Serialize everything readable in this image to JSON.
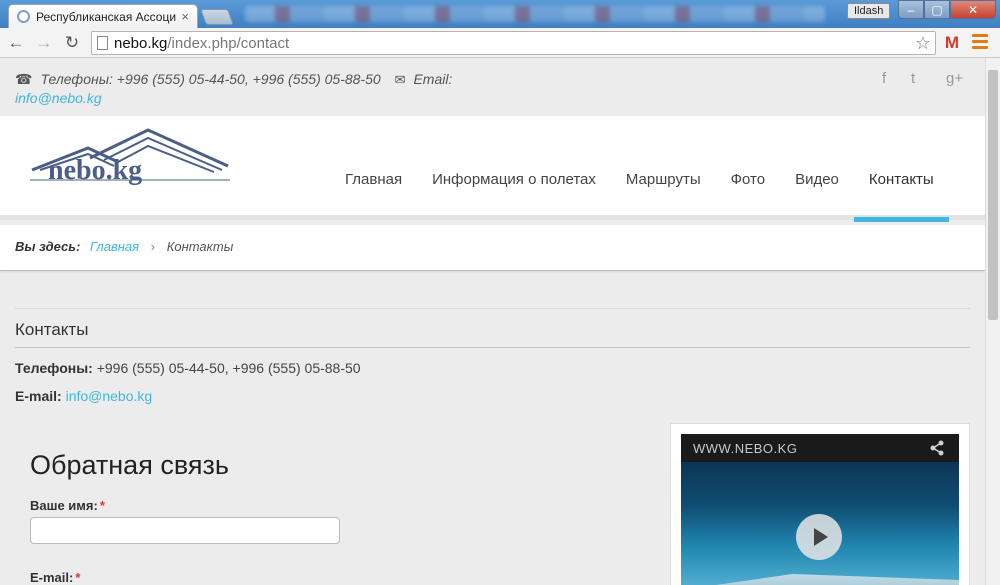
{
  "browser": {
    "tab_title": "Республиканская Ассоци",
    "tab_close": "×",
    "user": "Ildash",
    "url_host": "nebo.kg",
    "url_path": "/index.php/contact",
    "window_min": "–",
    "window_max": "▢",
    "window_close": "✕"
  },
  "topbar": {
    "phones_label": "Телефоны: +996 (555) 05-44-50, +996 (555) 05-88-50",
    "email_label": "Email:",
    "email": "info@nebo.kg",
    "social": [
      "f",
      "t",
      "g+"
    ]
  },
  "logo": {
    "text": "nebo.kg"
  },
  "nav": [
    {
      "label": "Главная"
    },
    {
      "label": "Информация о полетах"
    },
    {
      "label": "Маршруты"
    },
    {
      "label": "Фото"
    },
    {
      "label": "Видео"
    },
    {
      "label": "Контакты",
      "active": true
    }
  ],
  "breadcrumb": {
    "label": "Вы здесь:",
    "home": "Главная",
    "separator": "›",
    "current": "Контакты"
  },
  "contacts": {
    "title": "Контакты",
    "phones_label": "Телефоны:",
    "phones": "+996 (555) 05-44-50, +996 (555) 05-88-50",
    "email_label": "E-mail:",
    "email": "info@nebo.kg"
  },
  "form": {
    "title": "Обратная связь",
    "name_label": "Ваше имя:",
    "email_label": "E-mail:",
    "required_mark": "*"
  },
  "video": {
    "brand": "WWW.NEBO.KG"
  },
  "colors": {
    "accent": "#3fb7e0",
    "required": "#dd3333"
  }
}
